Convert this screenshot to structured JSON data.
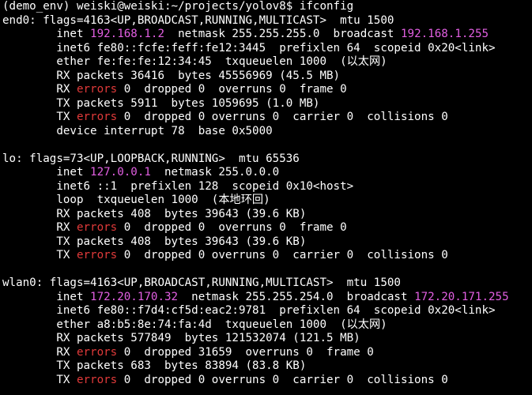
{
  "window": {
    "background": "#000000",
    "foreground": "#ffffff"
  },
  "colors": {
    "ip": "#e25fe2",
    "err": "#e03a3a",
    "def": "#ffffff"
  },
  "lines": [
    [
      {
        "t": "(demo_env) weiski@weiski:~/projects/yolov8$ ifconfig",
        "c": "def"
      }
    ],
    [
      {
        "t": "end0: flags=4163<UP,BROADCAST,RUNNING,MULTICAST>  mtu 1500",
        "c": "def"
      }
    ],
    [
      {
        "t": "        inet ",
        "c": "def"
      },
      {
        "t": "192.168.1.2",
        "c": "ip"
      },
      {
        "t": "  netmask 255.255.255.0  broadcast ",
        "c": "def"
      },
      {
        "t": "192.168.1.255",
        "c": "ip"
      }
    ],
    [
      {
        "t": "        inet6 fe80::fcfe:feff:fe12:3445  prefixlen 64  scopeid 0x20<link>",
        "c": "def"
      }
    ],
    [
      {
        "t": "        ether fe:fe:fe:12:34:45  txqueuelen 1000  (以太网)",
        "c": "def"
      }
    ],
    [
      {
        "t": "        RX packets 36416  bytes 45556969 (45.5 MB)",
        "c": "def"
      }
    ],
    [
      {
        "t": "        RX ",
        "c": "def"
      },
      {
        "t": "errors",
        "c": "err"
      },
      {
        "t": " 0  dropped 0  overruns 0  frame 0",
        "c": "def"
      }
    ],
    [
      {
        "t": "        TX packets 5911  bytes 1059695 (1.0 MB)",
        "c": "def"
      }
    ],
    [
      {
        "t": "        TX ",
        "c": "def"
      },
      {
        "t": "errors",
        "c": "err"
      },
      {
        "t": " 0  dropped 0 overruns 0  carrier 0  collisions 0",
        "c": "def"
      }
    ],
    [
      {
        "t": "        device interrupt 78  base 0x5000",
        "c": "def"
      }
    ],
    [
      {
        "t": "",
        "c": "def"
      }
    ],
    [
      {
        "t": "lo: flags=73<UP,LOOPBACK,RUNNING>  mtu 65536",
        "c": "def"
      }
    ],
    [
      {
        "t": "        inet ",
        "c": "def"
      },
      {
        "t": "127.0.0.1",
        "c": "ip"
      },
      {
        "t": "  netmask 255.0.0.0",
        "c": "def"
      }
    ],
    [
      {
        "t": "        inet6 ::1  prefixlen 128  scopeid 0x10<host>",
        "c": "def"
      }
    ],
    [
      {
        "t": "        loop  txqueuelen 1000  (本地环回)",
        "c": "def"
      }
    ],
    [
      {
        "t": "        RX packets 408  bytes 39643 (39.6 KB)",
        "c": "def"
      }
    ],
    [
      {
        "t": "        RX ",
        "c": "def"
      },
      {
        "t": "errors",
        "c": "err"
      },
      {
        "t": " 0  dropped 0  overruns 0  frame 0",
        "c": "def"
      }
    ],
    [
      {
        "t": "        TX packets 408  bytes 39643 (39.6 KB)",
        "c": "def"
      }
    ],
    [
      {
        "t": "        TX ",
        "c": "def"
      },
      {
        "t": "errors",
        "c": "err"
      },
      {
        "t": " 0  dropped 0 overruns 0  carrier 0  collisions 0",
        "c": "def"
      }
    ],
    [
      {
        "t": "",
        "c": "def"
      }
    ],
    [
      {
        "t": "wlan0: flags=4163<UP,BROADCAST,RUNNING,MULTICAST>  mtu 1500",
        "c": "def"
      }
    ],
    [
      {
        "t": "        inet ",
        "c": "def"
      },
      {
        "t": "172.20.170.32",
        "c": "ip"
      },
      {
        "t": "  netmask 255.255.254.0  broadcast ",
        "c": "def"
      },
      {
        "t": "172.20.171.255",
        "c": "ip"
      }
    ],
    [
      {
        "t": "        inet6 fe80::f7d4:cf5d:eac2:9781  prefixlen 64  scopeid 0x20<link>",
        "c": "def"
      }
    ],
    [
      {
        "t": "        ether a8:b5:8e:74:fa:4d  txqueuelen 1000  (以太网)",
        "c": "def"
      }
    ],
    [
      {
        "t": "        RX packets 577849  bytes 121532074 (121.5 MB)",
        "c": "def"
      }
    ],
    [
      {
        "t": "        RX ",
        "c": "def"
      },
      {
        "t": "errors",
        "c": "err"
      },
      {
        "t": " 0  dropped 31659  overruns 0  frame 0",
        "c": "def"
      }
    ],
    [
      {
        "t": "        TX packets 683  bytes 83894 (83.8 KB)",
        "c": "def"
      }
    ],
    [
      {
        "t": "        TX ",
        "c": "def"
      },
      {
        "t": "errors",
        "c": "err"
      },
      {
        "t": " 0  dropped 0 overruns 0  carrier 0  collisions 0",
        "c": "def"
      }
    ]
  ]
}
